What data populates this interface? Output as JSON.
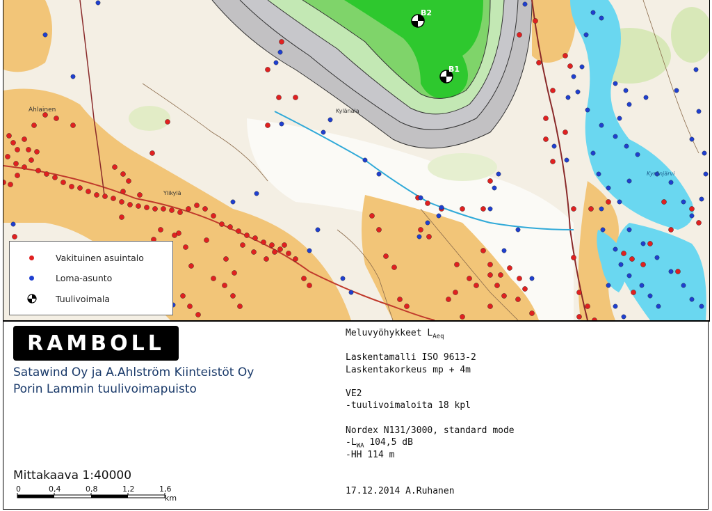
{
  "map": {
    "place_labels": {
      "ahlainen": "Ahlainen",
      "ylikyla": "Ylikylä",
      "kylanala": "Kylänala",
      "lake": "Kyrönjärvi"
    },
    "turbines": [
      {
        "label": "B2"
      },
      {
        "label": "B1"
      }
    ]
  },
  "legend": {
    "items": [
      {
        "label": "Vakituinen asuintalo",
        "color": "#e02020",
        "symbol": "red-dot"
      },
      {
        "label": "Loma-asunto",
        "color": "#1f3fd0",
        "symbol": "blue-dot"
      },
      {
        "label": "Tuulivoimala",
        "symbol": "turbine-icon"
      }
    ]
  },
  "titleblock": {
    "logo": "RAMBOLL",
    "client_line1": "Satawind Oy ja A.Ahlström Kiinteistöt Oy",
    "client_line2": "Porin Lammin tuulivoimapuisto",
    "scale": {
      "title": "Mittakaava 1:40000",
      "ticks": [
        "0",
        "0,4",
        "0,8",
        "1,2",
        "1,6"
      ],
      "unit": "km"
    },
    "info": {
      "heading_main": "Meluvyöhykkeet L",
      "heading_sub": "Aeq",
      "model": "Laskentamalli ISO 9613-2",
      "height": "Laskentakorkeus mp + 4m",
      "variant": "VE2",
      "turbines_count": "-tuulivoimaloita 18 kpl",
      "turbine_model": "Nordex N131/3000, standard mode",
      "lwa_prefix": "-L",
      "lwa_sub": "WA",
      "lwa_value": " 104,5 dB",
      "hub_height": "-HH 114 m",
      "date_author": "17.12.2014 A.Ruhanen"
    }
  }
}
